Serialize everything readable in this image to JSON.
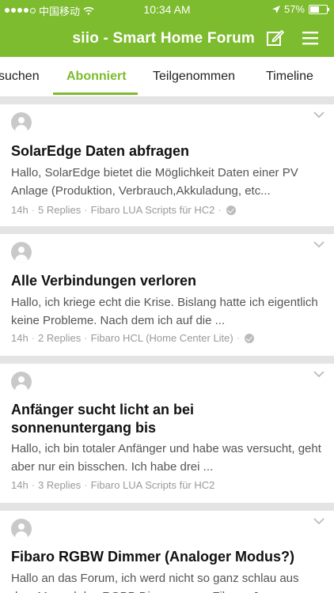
{
  "status": {
    "carrier": "中国移动",
    "time": "10:34 AM",
    "battery": "57%",
    "battery_level": 0.57
  },
  "header": {
    "title": "siio - Smart Home Forum"
  },
  "tabs": [
    {
      "label": "suchen"
    },
    {
      "label": "Abonniert"
    },
    {
      "label": "Teilgenommen"
    },
    {
      "label": "Timeline"
    }
  ],
  "accent_color": "#7dbb2f",
  "posts": [
    {
      "title": "SolarEdge Daten abfragen",
      "excerpt": "Hallo, SolarEdge bietet die Möglichkeit Daten einer PV Anlage (Produktion, Verbrauch,Akkuladung, etc...",
      "time": "14h",
      "replies": "5 Replies",
      "forum": "Fibaro LUA Scripts für HC2"
    },
    {
      "title": "Alle Verbindungen verloren",
      "excerpt": "Hallo, ich kriege echt die Krise. Bislang hatte ich eigentlich keine Probleme. Nach dem ich auf die ...",
      "time": "14h",
      "replies": "2 Replies",
      "forum": "Fibaro HCL (Home Center Lite)"
    },
    {
      "title": "Anfänger sucht licht an bei sonnenuntergang bis",
      "excerpt": "Hallo,  ich bin totaler Anfänger und habe was versucht, geht aber nur ein bisschen. Ich habe drei ...",
      "time": "14h",
      "replies": "3 Replies",
      "forum": "Fibaro LUA Scripts für HC2"
    },
    {
      "title": "Fibaro RGBW Dimmer (Analoger Modus?)",
      "excerpt": "Hallo an das Forum, ich werd nicht so ganz schlau aus dem Manuel des RGBB Dimmers von Fibaro. Ja"
    }
  ]
}
